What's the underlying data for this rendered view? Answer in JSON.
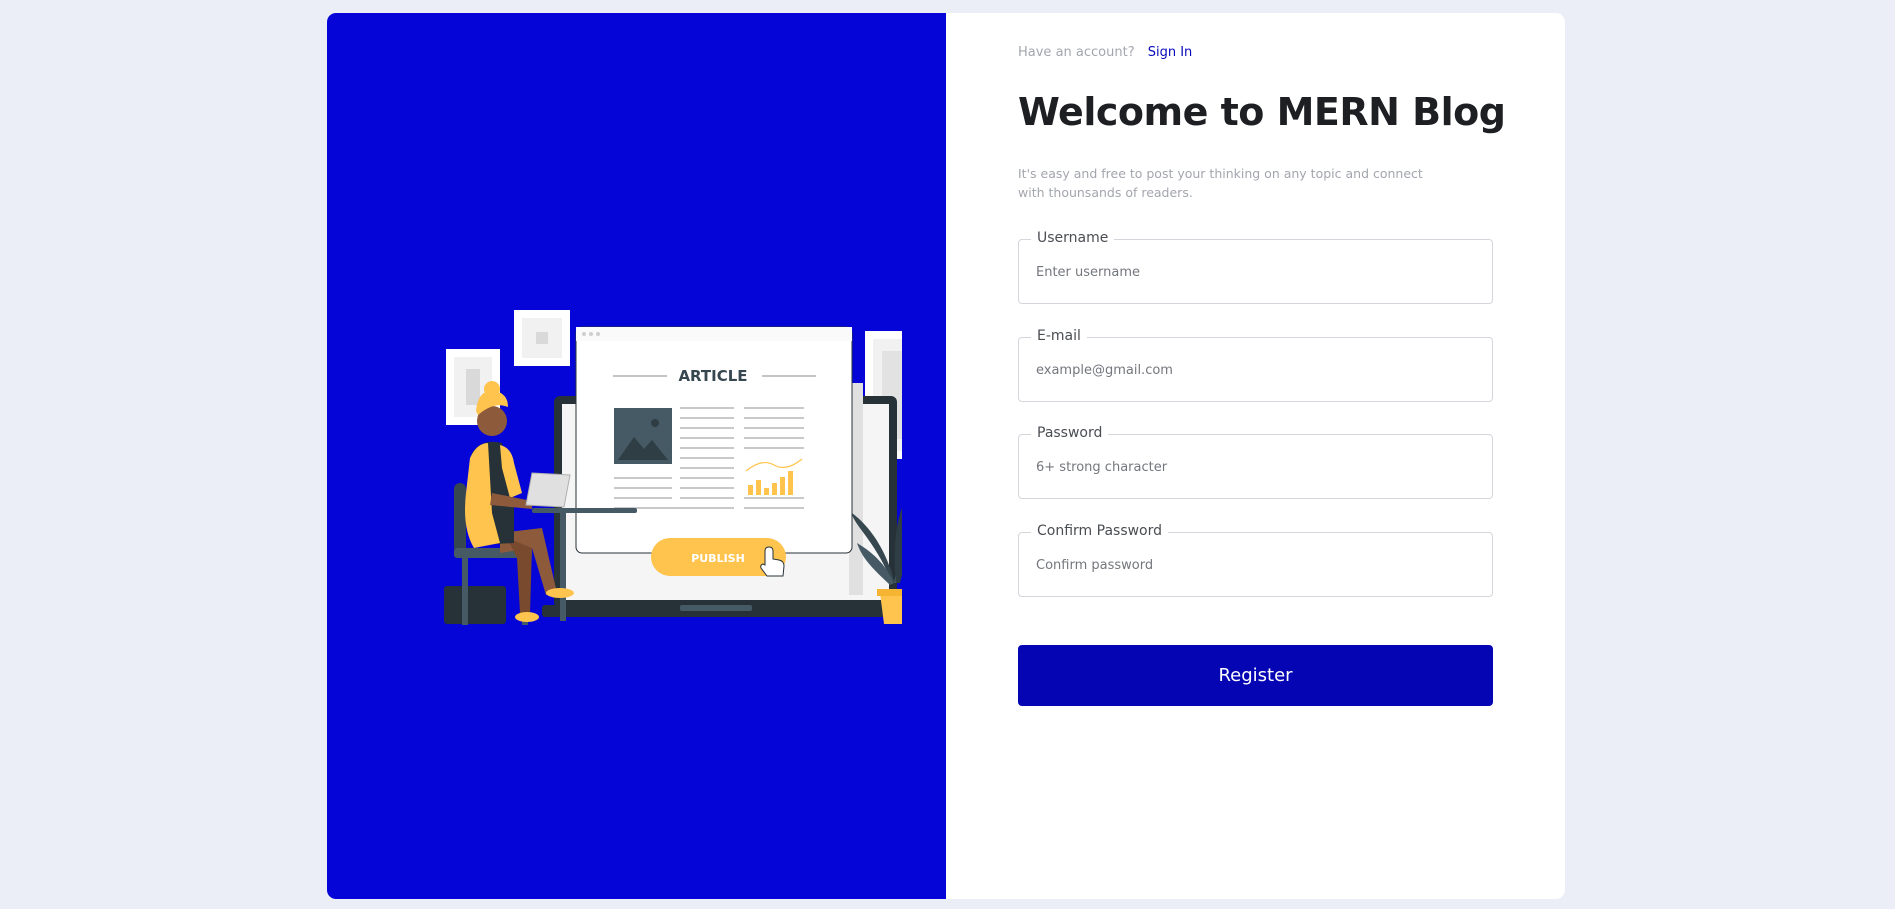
{
  "header": {
    "have_account_text": "Have an account?",
    "signin_link": "Sign In"
  },
  "main": {
    "title": "Welcome to MERN Blog",
    "subtitle": "It's easy and free to post your thinking on any topic and connect with thounsands of readers."
  },
  "form": {
    "fields": [
      {
        "label": "Username",
        "placeholder": "Enter username",
        "value": ""
      },
      {
        "label": "E-mail",
        "placeholder": "example@gmail.com",
        "value": ""
      },
      {
        "label": "Password",
        "placeholder": "6+ strong character",
        "value": ""
      },
      {
        "label": "Confirm Password",
        "placeholder": "Confirm password",
        "value": ""
      }
    ],
    "submit_label": "Register"
  },
  "illustration": {
    "article_heading": "ARTICLE",
    "publish_label": "PUBLISH"
  },
  "colors": {
    "left_panel_bg": "#0505d8",
    "button_bg": "#0505b4",
    "link": "#0909b8",
    "page_bg": "#ebeef7",
    "accent_yellow": "#ffc44d"
  },
  "icons": [
    "article-icon",
    "image-placeholder-icon",
    "bar-chart-icon",
    "hand-cursor-icon",
    "plant-icon"
  ]
}
